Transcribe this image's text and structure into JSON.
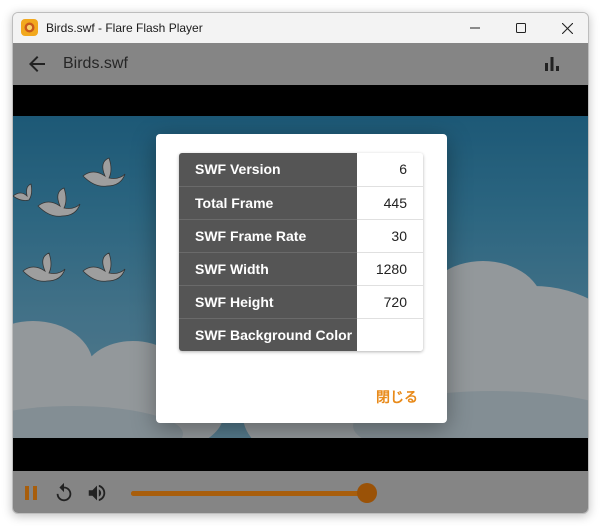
{
  "window": {
    "title": "Birds.swf - Flare Flash Player"
  },
  "header": {
    "file_title": "Birds.swf"
  },
  "icons": {
    "app": "flare-app-icon",
    "back": "arrow-left-icon",
    "stats": "bar-chart-icon",
    "pause": "pause-icon",
    "replay": "replay-icon",
    "volume": "volume-icon"
  },
  "swf_info": {
    "rows": [
      {
        "key": "SWF Version",
        "value": "6"
      },
      {
        "key": "Total Frame",
        "value": "445"
      },
      {
        "key": "SWF Frame Rate",
        "value": "30"
      },
      {
        "key": "SWF Width",
        "value": "1280"
      },
      {
        "key": "SWF Height",
        "value": "720"
      },
      {
        "key": "SWF Background Color",
        "value": ""
      }
    ],
    "close_label": "閉じる"
  },
  "controls": {
    "volume_level": 0.99
  },
  "colors": {
    "accent": "#e88a1a",
    "slider": "#a85e0c",
    "header_bg": "#858585",
    "table_key_bg": "#555555"
  }
}
